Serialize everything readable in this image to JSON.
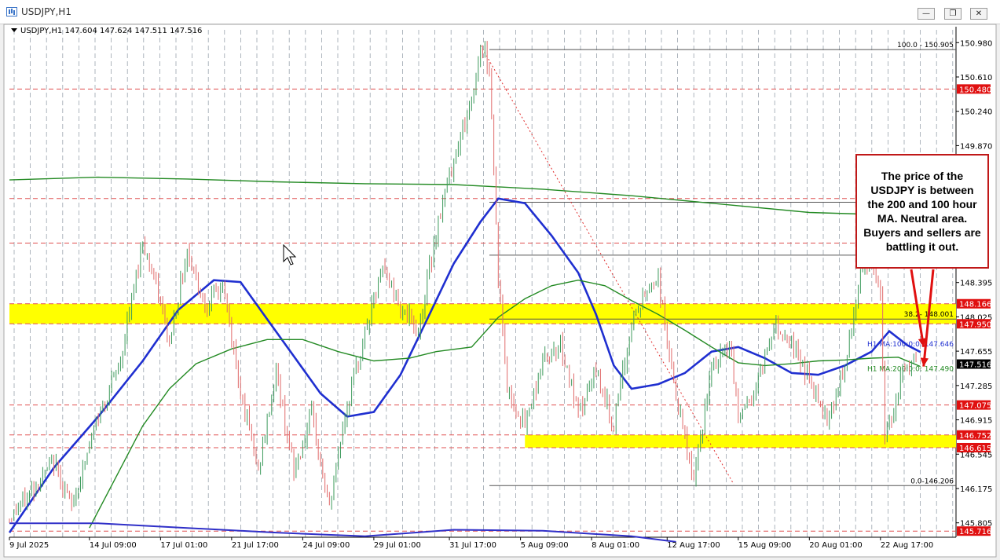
{
  "window": {
    "title": "USDJPY,H1",
    "buttons": {
      "minimize": "—",
      "maximize": "❐",
      "close": "✕"
    }
  },
  "header": {
    "ohlc": "USDJPY,H1  147.604 147.624 147.511 147.516"
  },
  "annotation": {
    "text": "The price of the USDJPY is between the 200 and 100 hour MA.  Neutral area.  Buyers and sellers are battling it out."
  },
  "colors": {
    "background": "#ffffff",
    "grid": "#9aa3ad",
    "candle_up": "#3d9a5c",
    "candle_down": "#e06a6a",
    "ma100": "#1f2fd0",
    "ma200": "#238a23",
    "ma_long_blue": "#3030c8",
    "level_red": "#e05050",
    "tag_red": "#e01010",
    "zone_yellow": "#ffff00",
    "fib": "#555555",
    "arrow": "#e01010",
    "current_price_tag": "#000000"
  },
  "chart_data": {
    "type": "candlestick",
    "symbol": "USDJPY",
    "timeframe": "H1",
    "y_range": [
      145.65,
      151.05
    ],
    "x_tick_labels": [
      "9 Jul 2025",
      "14 Jul 09:00",
      "17 Jul 01:00",
      "21 Jul 17:00",
      "24 Jul 09:00",
      "29 Jul 01:00",
      "31 Jul 17:00",
      "5 Aug 09:00",
      "8 Aug 01:00",
      "12 Aug 17:00",
      "15 Aug 09:00",
      "20 Aug 01:00",
      "22 Aug 17:00"
    ],
    "y_tick_labels": [
      "150.980",
      "150.610",
      "150.240",
      "149.870",
      "148.395",
      "148.025",
      "147.655",
      "147.285",
      "146.915",
      "146.545",
      "146.175",
      "145.805"
    ],
    "price_path": [
      [
        0,
        145.85
      ],
      [
        10,
        146.45
      ],
      [
        14,
        145.98
      ],
      [
        20,
        146.95
      ],
      [
        25,
        147.55
      ],
      [
        30,
        148.85
      ],
      [
        33,
        148.35
      ],
      [
        36,
        147.75
      ],
      [
        40,
        148.75
      ],
      [
        44,
        148.15
      ],
      [
        48,
        148.35
      ],
      [
        52,
        147.25
      ],
      [
        56,
        146.35
      ],
      [
        60,
        147.45
      ],
      [
        64,
        146.35
      ],
      [
        68,
        146.95
      ],
      [
        72,
        145.95
      ],
      [
        75,
        146.85
      ],
      [
        80,
        147.85
      ],
      [
        84,
        148.55
      ],
      [
        88,
        148.15
      ],
      [
        92,
        147.85
      ],
      [
        96,
        148.95
      ],
      [
        100,
        149.75
      ],
      [
        104,
        150.35
      ],
      [
        106,
        150.95
      ],
      [
        108,
        150.75
      ],
      [
        110,
        148.45
      ],
      [
        112,
        147.25
      ],
      [
        116,
        146.85
      ],
      [
        120,
        147.55
      ],
      [
        124,
        147.75
      ],
      [
        128,
        146.95
      ],
      [
        132,
        147.45
      ],
      [
        136,
        146.85
      ],
      [
        140,
        147.95
      ],
      [
        144,
        148.35
      ],
      [
        146,
        148.45
      ],
      [
        148,
        147.75
      ],
      [
        150,
        147.15
      ],
      [
        154,
        146.25
      ],
      [
        156,
        146.85
      ],
      [
        158,
        147.45
      ],
      [
        162,
        147.75
      ],
      [
        164,
        146.95
      ],
      [
        168,
        147.25
      ],
      [
        172,
        147.95
      ],
      [
        176,
        147.75
      ],
      [
        180,
        147.35
      ],
      [
        184,
        146.95
      ],
      [
        188,
        147.45
      ],
      [
        190,
        148.05
      ],
      [
        192,
        148.55
      ],
      [
        194,
        148.65
      ],
      [
        196,
        148.25
      ],
      [
        197,
        146.75
      ],
      [
        199,
        147.05
      ],
      [
        201,
        147.45
      ],
      [
        204,
        147.52
      ]
    ],
    "levels": [
      {
        "price": 150.48,
        "label": "150.480",
        "style": "dashed-red-tag"
      },
      {
        "price": 148.166,
        "label": "148.166",
        "style": "dashed-red-tag"
      },
      {
        "price": 147.95,
        "label": "147.950",
        "style": "dashed-red-tag"
      },
      {
        "price": 147.075,
        "label": "147.075",
        "style": "dashed-red-tag"
      },
      {
        "price": 146.752,
        "label": "146.752",
        "style": "dashed-red-tag"
      },
      {
        "price": 146.615,
        "label": "146.615",
        "style": "dashed-red-tag"
      },
      {
        "price": 145.716,
        "label": "145.716",
        "style": "dashed-red-tag"
      },
      {
        "price": 148.82,
        "style": "dashed-red"
      },
      {
        "price": 149.3,
        "style": "dashed-red"
      }
    ],
    "current_price": {
      "price": 147.516,
      "label": "147.516"
    },
    "zones": [
      {
        "from_price": 147.95,
        "to_price": 148.166,
        "x_start": 0,
        "x_end": 213
      },
      {
        "from_price": 146.615,
        "to_price": 146.752,
        "x_start": 116,
        "x_end": 213
      }
    ],
    "fibonacci": [
      {
        "price": 150.905,
        "label": "100.0 - 150.905"
      },
      {
        "price": 149.26
      },
      {
        "price": 148.69
      },
      {
        "price": 148.001,
        "label": "38.2- 148.001"
      },
      {
        "price": 146.206,
        "label": "0.0-146.206"
      }
    ],
    "fib_trend_line": {
      "from": [
        106,
        150.95
      ],
      "to": [
        163,
        146.22
      ]
    },
    "series": [
      {
        "name": "H1 MA:100:0:0: 147.646",
        "color_key": "ma100",
        "values": [
          [
            0,
            145.7
          ],
          [
            10,
            146.4
          ],
          [
            20,
            146.95
          ],
          [
            30,
            147.55
          ],
          [
            38,
            148.1
          ],
          [
            46,
            148.42
          ],
          [
            52,
            148.4
          ],
          [
            58,
            148.0
          ],
          [
            64,
            147.6
          ],
          [
            70,
            147.2
          ],
          [
            76,
            146.95
          ],
          [
            82,
            147.0
          ],
          [
            88,
            147.4
          ],
          [
            94,
            148.0
          ],
          [
            100,
            148.6
          ],
          [
            106,
            149.05
          ],
          [
            110,
            149.3
          ],
          [
            116,
            149.25
          ],
          [
            122,
            148.9
          ],
          [
            128,
            148.5
          ],
          [
            132,
            148.05
          ],
          [
            136,
            147.5
          ],
          [
            140,
            147.25
          ],
          [
            146,
            147.3
          ],
          [
            152,
            147.42
          ],
          [
            158,
            147.65
          ],
          [
            164,
            147.7
          ],
          [
            170,
            147.58
          ],
          [
            176,
            147.42
          ],
          [
            182,
            147.4
          ],
          [
            188,
            147.5
          ],
          [
            194,
            147.65
          ],
          [
            198,
            147.87
          ],
          [
            202,
            147.72
          ],
          [
            205,
            147.646
          ]
        ]
      },
      {
        "name": "H1 MA:200:0:0: 147.490",
        "color_key": "ma200",
        "values": [
          [
            18,
            145.75
          ],
          [
            24,
            146.3
          ],
          [
            30,
            146.85
          ],
          [
            36,
            147.25
          ],
          [
            42,
            147.52
          ],
          [
            50,
            147.68
          ],
          [
            58,
            147.78
          ],
          [
            66,
            147.78
          ],
          [
            74,
            147.65
          ],
          [
            82,
            147.55
          ],
          [
            90,
            147.58
          ],
          [
            96,
            147.65
          ],
          [
            104,
            147.7
          ],
          [
            110,
            148.02
          ],
          [
            116,
            148.22
          ],
          [
            122,
            148.36
          ],
          [
            128,
            148.42
          ],
          [
            134,
            148.36
          ],
          [
            140,
            148.2
          ],
          [
            146,
            148.05
          ],
          [
            152,
            147.88
          ],
          [
            158,
            147.7
          ],
          [
            164,
            147.53
          ],
          [
            170,
            147.5
          ],
          [
            176,
            147.52
          ],
          [
            182,
            147.55
          ],
          [
            188,
            147.56
          ],
          [
            194,
            147.58
          ],
          [
            200,
            147.59
          ],
          [
            205,
            147.49
          ]
        ]
      },
      {
        "color_key": "ma200",
        "values": [
          [
            0,
            149.5
          ],
          [
            20,
            149.53
          ],
          [
            40,
            149.51
          ],
          [
            60,
            149.48
          ],
          [
            80,
            149.46
          ],
          [
            100,
            149.45
          ],
          [
            120,
            149.4
          ],
          [
            140,
            149.33
          ],
          [
            160,
            149.24
          ],
          [
            180,
            149.15
          ],
          [
            200,
            149.12
          ],
          [
            213,
            149.1
          ]
        ]
      },
      {
        "color_key": "ma_long_blue",
        "values": [
          [
            0,
            145.8
          ],
          [
            20,
            145.8
          ],
          [
            40,
            145.75
          ],
          [
            60,
            145.7
          ],
          [
            80,
            145.66
          ],
          [
            100,
            145.73
          ],
          [
            120,
            145.72
          ],
          [
            140,
            145.66
          ],
          [
            150,
            145.6
          ]
        ]
      }
    ]
  }
}
